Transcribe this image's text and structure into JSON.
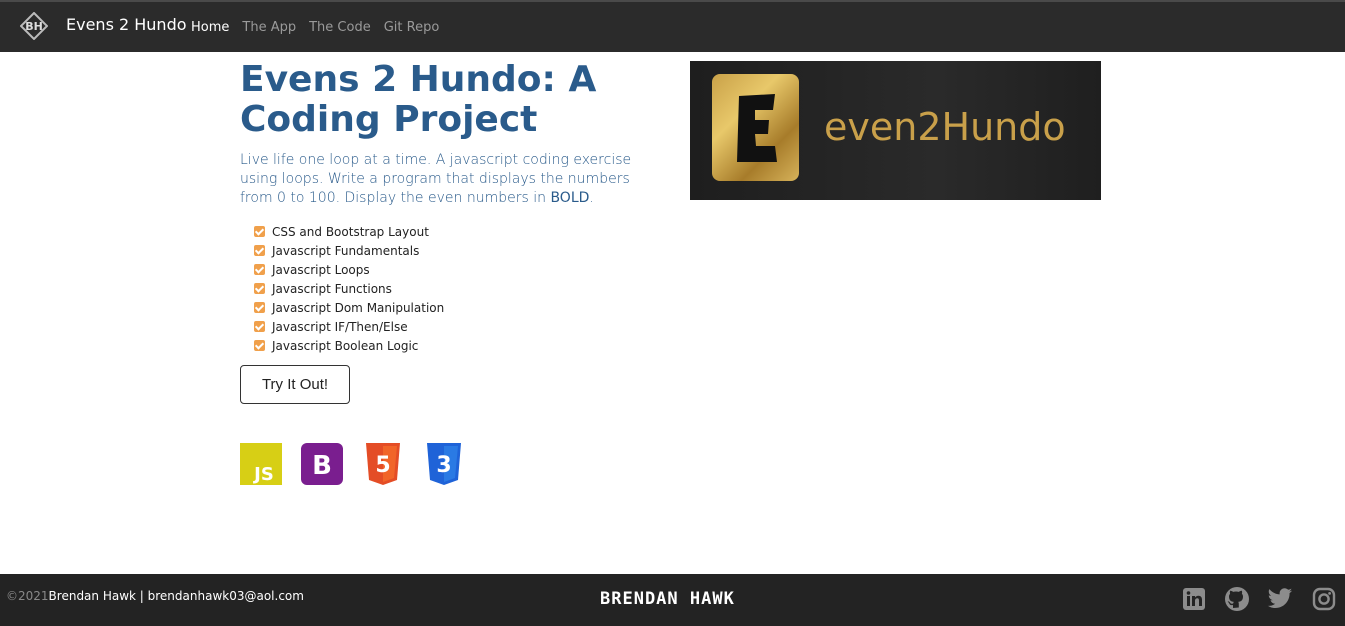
{
  "navbar": {
    "brand_name": "Evens 2 Hundo",
    "links": [
      {
        "label": "Home",
        "active": true
      },
      {
        "label": "The App",
        "active": false
      },
      {
        "label": "The Code",
        "active": false
      },
      {
        "label": "Git Repo",
        "active": false
      }
    ]
  },
  "hero": {
    "title": "Evens 2 Hundo: A Coding Project",
    "description": "Live life one loop at a time. A javascript coding exercise using loops. Write a program that displays the numbers from 0 to 100. Display the even numbers in ",
    "description_bold": "BOLD",
    "description_end": ".",
    "checklist": [
      "CSS and Bootstrap Layout",
      "Javascript Fundamentals",
      "Javascript Loops",
      "Javascript Functions",
      "Javascript Dom Manipulation",
      "Javascript IF/Then/Else",
      "Javascript Boolean Logic"
    ],
    "button_label": "Try It Out!",
    "tech_icons": [
      "javascript-icon",
      "bootstrap-icon",
      "html5-icon",
      "css3-icon"
    ]
  },
  "banner": {
    "emblem_letter": "E",
    "text": "even2Hundo"
  },
  "footer": {
    "copyright": "©2021",
    "author_contact": "Brendan Hawk | brendanhawk03@aol.com",
    "center_name": "BRENDAN HAWK",
    "social_icons": [
      "linkedin-icon",
      "github-icon",
      "twitter-icon",
      "instagram-icon"
    ]
  },
  "colors": {
    "navbar_bg": "#2b2b2b",
    "title_blue": "#2a5b8b",
    "check_orange": "#f0a04b",
    "js_yellow": "#d7cf15",
    "bootstrap_purple": "#7a1e8f",
    "html_orange": "#e44d26",
    "css_blue": "#1f63d8",
    "gold": "#c9a04a"
  }
}
